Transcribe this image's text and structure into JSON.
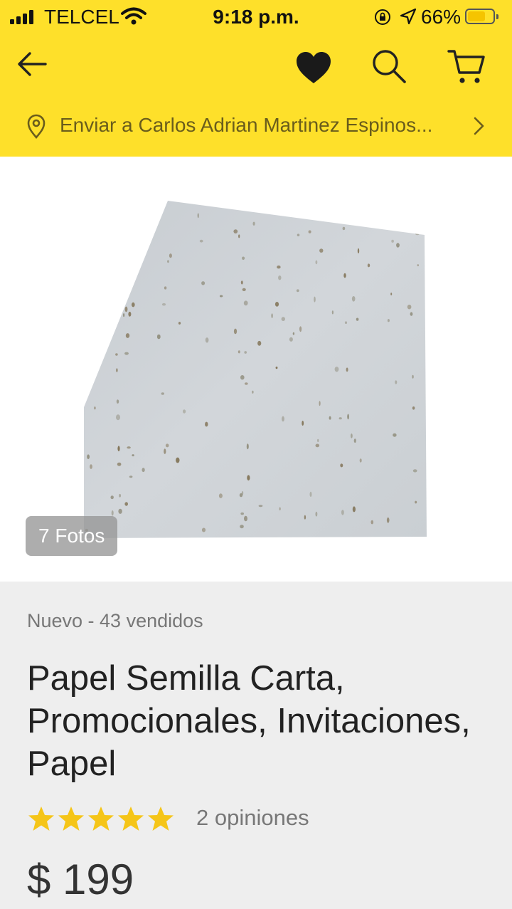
{
  "status_bar": {
    "carrier": "TELCEL",
    "time": "9:18 p.m.",
    "battery": "66%",
    "battery_level": 0.66
  },
  "nav": {
    "icons": [
      "back-arrow-icon",
      "heart-icon",
      "search-icon",
      "cart-icon"
    ]
  },
  "address": {
    "text": "Enviar a Carlos Adrian Martinez Espinos..."
  },
  "gallery": {
    "photo_count": "7 Fotos"
  },
  "product": {
    "condition": "Nuevo - 43 vendidos",
    "title": "Papel Semilla Carta, Promocionales, Invitaciones, Papel",
    "rating": 5,
    "reviews": "2 opiniones",
    "price": "$ 199"
  },
  "colors": {
    "brand_yellow": "#fee02a",
    "star": "#f5c518"
  }
}
